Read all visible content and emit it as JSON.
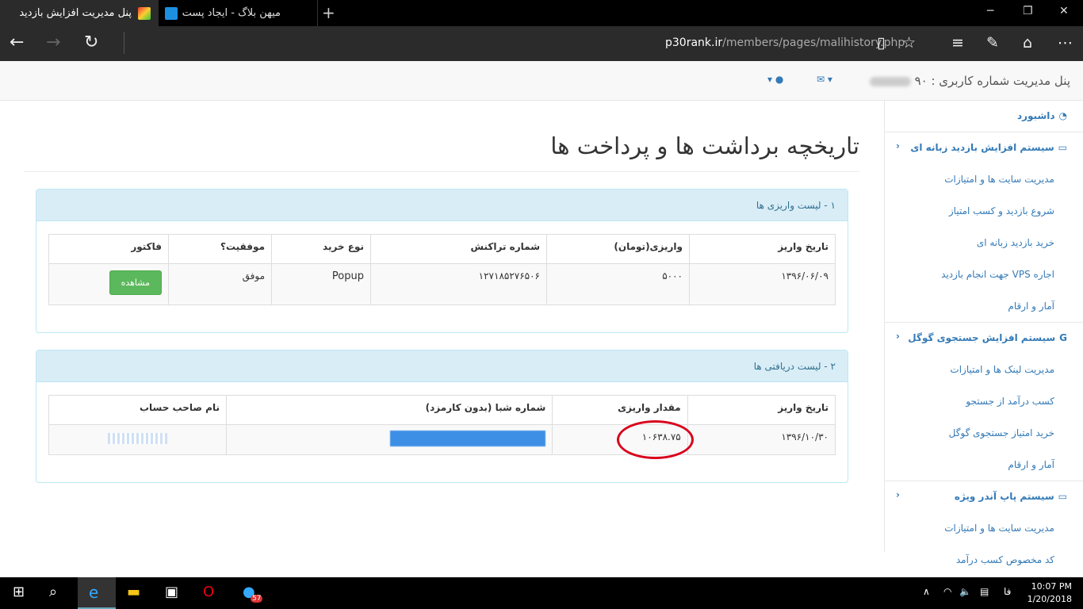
{
  "browser": {
    "tab_active_title": "پنل مدیریت افزایش بازدید",
    "tab_2_title": "میهن بلاگ - ایجاد پست",
    "url_host": "p30rank.ir",
    "url_path": "/members/pages/malihistory.php"
  },
  "header": {
    "brand_text": "پنل مدیریت شماره کاربری : ۹۰"
  },
  "sidebar": {
    "items": [
      {
        "label": "داشبورد",
        "type": "top"
      },
      {
        "label": "سیستم افزایش بازدید زبانه ای",
        "type": "section"
      },
      {
        "label": "مدیریت سایت ها و امتیازات",
        "type": "sub"
      },
      {
        "label": "شروع بازدید و کسب امتیاز",
        "type": "sub"
      },
      {
        "label": "خرید بازدید زبانه ای",
        "type": "sub"
      },
      {
        "label": "اجاره VPS جهت انجام بازدید",
        "type": "sub"
      },
      {
        "label": "آمار و ارقام",
        "type": "sub"
      },
      {
        "label": "سیستم افزایش جستجوی گوگل",
        "type": "section"
      },
      {
        "label": "مدیریت لینک ها و امتیازات",
        "type": "sub"
      },
      {
        "label": "کسب درآمد از جستجو",
        "type": "sub"
      },
      {
        "label": "خرید امتیاز جستجوی گوگل",
        "type": "sub"
      },
      {
        "label": "آمار و ارقام",
        "type": "sub"
      },
      {
        "label": "سیستم پاپ آندر ویژه",
        "type": "section"
      },
      {
        "label": "مدیریت سایت ها و امتیازات",
        "type": "sub"
      },
      {
        "label": "کد مخصوص کسب درآمد",
        "type": "sub"
      }
    ]
  },
  "main": {
    "title": "تاریخچه برداشت ها و پرداخت ها",
    "deposits": {
      "heading": "۱ - لیست واریزی ها",
      "columns": [
        "تاریخ واریز",
        "واریزی(تومان)",
        "شماره تراکنش",
        "نوع خرید",
        "موفقیت؟",
        "فاکتور"
      ],
      "rows": [
        {
          "date": "۱۳۹۶/۰۶/۰۹",
          "amount": "۵۰۰۰",
          "txn": "۱۲۷۱۸۵۲۷۶۵۰۶",
          "type": "Popup",
          "status": "موفق",
          "action": "مشاهده"
        }
      ]
    },
    "receipts": {
      "heading": "۲ - لیست دریافتی ها",
      "columns": [
        "تاریخ واریز",
        "مقدار واریزی",
        "شماره شبا (بدون کارمزد)",
        "نام صاحب حساب"
      ],
      "rows": [
        {
          "date": "۱۳۹۶/۱۰/۳۰",
          "amount": "۱۰۶۳۸.۷۵"
        }
      ]
    }
  },
  "taskbar": {
    "time": "10:07 PM",
    "date": "1/20/2018",
    "lang": "فا",
    "badge": "57"
  }
}
